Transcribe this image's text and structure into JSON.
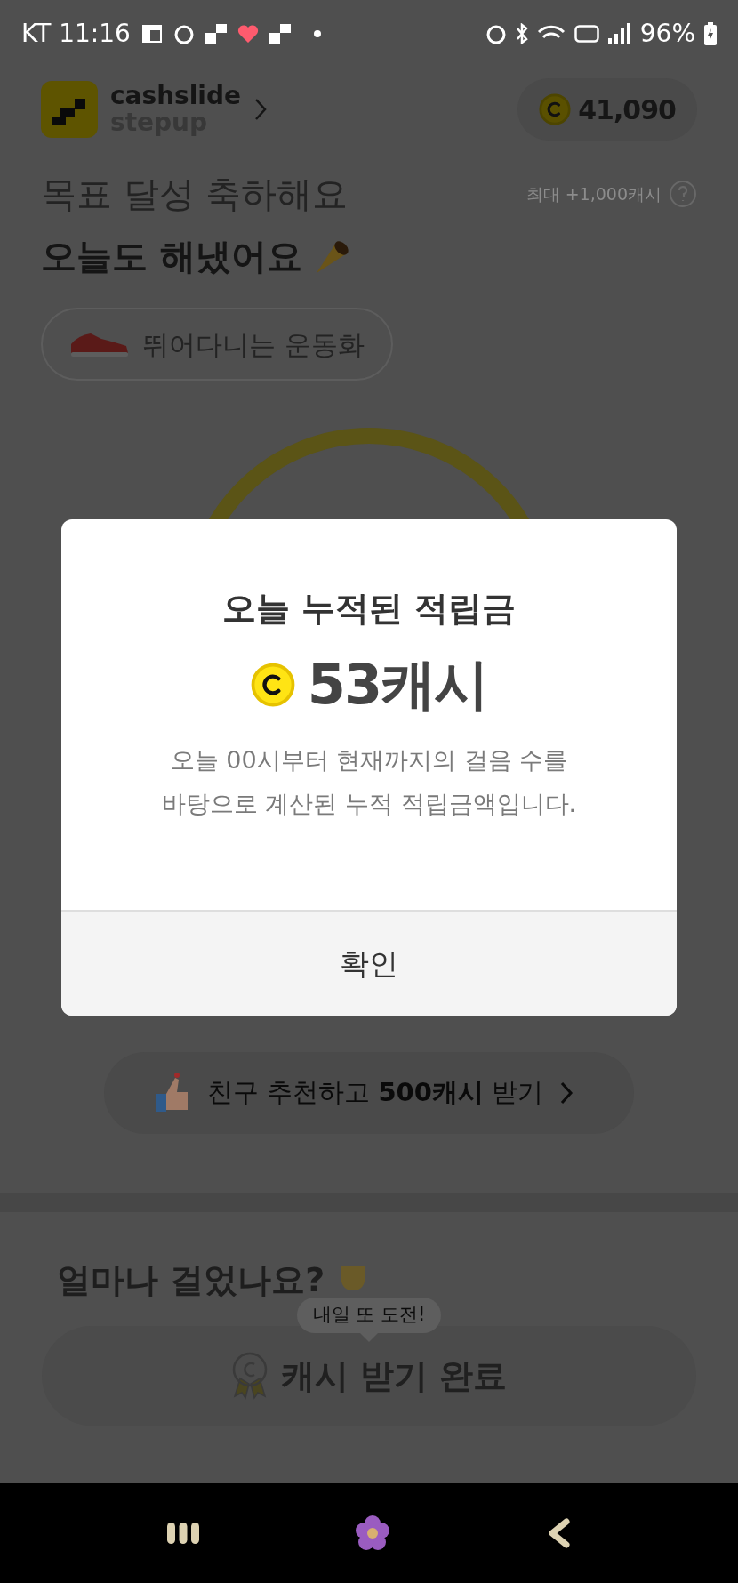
{
  "status_bar": {
    "carrier_time": "KT 11:16",
    "battery": "96%"
  },
  "header": {
    "brand_line_1": "cashslide",
    "brand_line_2": "stepup",
    "balance": "41,090"
  },
  "goal": {
    "title": "목표 달성 축하해요",
    "max_reward": "최대 +1,000캐시",
    "headline": "오늘도 해냈어요",
    "badge": "뛰어다니는 운동화"
  },
  "referral": {
    "text": "친구 추천하고 **500캐시** 받기"
  },
  "section_title": "얼마나 걸었나요?",
  "tooltip": "내일 또 도전!",
  "claim_button": {
    "label": "캐시 받기 완료"
  },
  "dialog": {
    "title": "오늘 누적된 적립금",
    "amount": "53캐시",
    "description_lines": [
      "오늘 00시부터 현재까지의 걸음 수를",
      "바탕으로 계산된 누적 적립금액입니다."
    ],
    "confirm": "확인"
  }
}
